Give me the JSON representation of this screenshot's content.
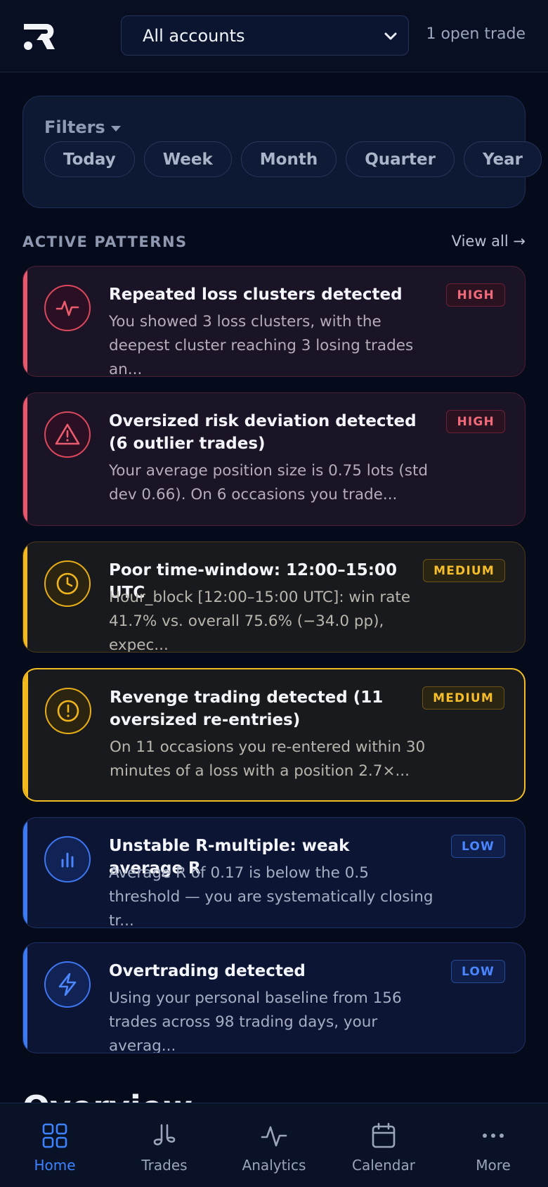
{
  "header": {
    "account_select": "All accounts",
    "open_trades": "1 open trade"
  },
  "filters": {
    "title": "Filters",
    "chips": [
      "Today",
      "Week",
      "Month",
      "Quarter",
      "Year"
    ]
  },
  "patterns_section": {
    "title": "ACTIVE PATTERNS",
    "view_all": "View all →",
    "items": [
      {
        "title": "Repeated loss clusters detected",
        "description": "You showed 3 loss clusters, with the deepest cluster reaching 3 losing trades an...",
        "severity": "HIGH",
        "icon": "pulse-icon"
      },
      {
        "title": "Oversized risk deviation detected (6 outlier trades)",
        "description": "Your average position size is 0.75 lots (std dev 0.66). On 6 occasions you trade...",
        "severity": "HIGH",
        "icon": "warning-triangle-icon"
      },
      {
        "title": "Poor time-window: 12:00–15:00 UTC",
        "description": "Hour_block [12:00–15:00 UTC]: win rate 41.7% vs. overall 75.6% (−34.0 pp), expec...",
        "severity": "MEDIUM",
        "icon": "clock-icon"
      },
      {
        "title": "Revenge trading detected (11 oversized re-entries)",
        "description": "On 11 occasions you re-entered within 30 minutes of a loss with a position 2.7×...",
        "severity": "MEDIUM",
        "icon": "alert-circle-icon"
      },
      {
        "title": "Unstable R-multiple: weak average R",
        "description": "Average R of 0.17 is below the 0.5 threshold — you are systematically closing tr...",
        "severity": "LOW",
        "icon": "bar-chart-icon"
      },
      {
        "title": "Overtrading detected",
        "description": "Using your personal baseline from 156 trades across 98 trading days, your averag...",
        "severity": "LOW",
        "icon": "lightning-icon"
      }
    ]
  },
  "overview_heading": "Overview",
  "nav": {
    "items": [
      {
        "label": "Home",
        "icon": "grid-icon",
        "active": true
      },
      {
        "label": "Trades",
        "icon": "trades-icon",
        "active": false
      },
      {
        "label": "Analytics",
        "icon": "pulse-icon",
        "active": false
      },
      {
        "label": "Calendar",
        "icon": "calendar-icon",
        "active": false
      },
      {
        "label": "More",
        "icon": "more-dots-icon",
        "active": false
      }
    ]
  },
  "colors": {
    "background": "#060b1c",
    "high": "#e8576b",
    "medium": "#f2b81c",
    "low": "#3b7af2",
    "accent": "#3d82ff"
  }
}
